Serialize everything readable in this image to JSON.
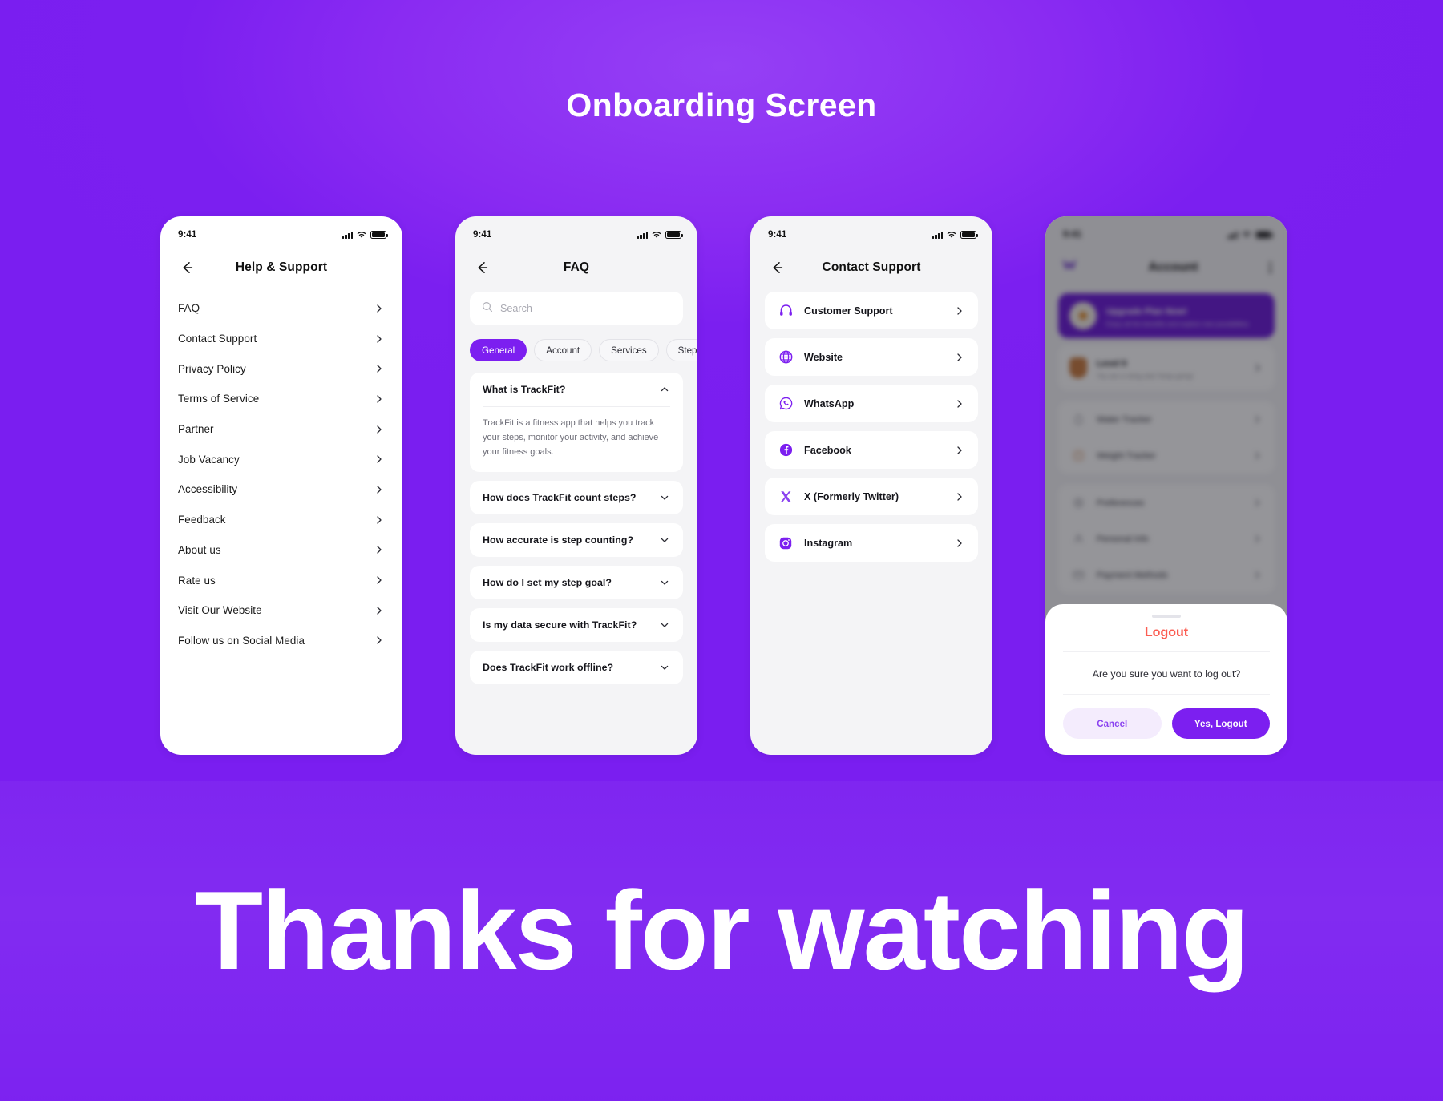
{
  "header": {
    "title": "Onboarding Screen"
  },
  "footer": {
    "title": "Thanks for watching"
  },
  "theme": {
    "brand_purple": "#7c1ff0",
    "bg_purple": "#7a1ef0",
    "danger_red": "#fb5d52",
    "card_white": "#ffffff",
    "screen_grey": "#f4f4f6"
  },
  "status_bar": {
    "time": "9:41"
  },
  "screens": {
    "help_support": {
      "nav_title": "Help & Support",
      "back_icon": "arrow-left-icon",
      "items": [
        {
          "label": "FAQ"
        },
        {
          "label": "Contact Support"
        },
        {
          "label": "Privacy Policy"
        },
        {
          "label": "Terms of Service"
        },
        {
          "label": "Partner"
        },
        {
          "label": "Job Vacancy"
        },
        {
          "label": "Accessibility"
        },
        {
          "label": "Feedback"
        },
        {
          "label": "About us"
        },
        {
          "label": "Rate us"
        },
        {
          "label": "Visit Our Website"
        },
        {
          "label": "Follow us on Social Media"
        }
      ]
    },
    "faq": {
      "nav_title": "FAQ",
      "back_icon": "arrow-left-icon",
      "search": {
        "placeholder": "Search",
        "value": "",
        "icon": "search-icon"
      },
      "chips": [
        {
          "label": "General",
          "active": true
        },
        {
          "label": "Account",
          "active": false
        },
        {
          "label": "Services",
          "active": false
        },
        {
          "label": "Steps",
          "active": false
        }
      ],
      "questions": [
        {
          "question": "What is TrackFit?",
          "expanded": true,
          "answer": "TrackFit is a fitness app that helps you track your steps, monitor your activity, and achieve your fitness goals."
        },
        {
          "question": "How does TrackFit count steps?",
          "expanded": false,
          "answer": ""
        },
        {
          "question": "How accurate is step counting?",
          "expanded": false,
          "answer": ""
        },
        {
          "question": "How do I set my step goal?",
          "expanded": false,
          "answer": ""
        },
        {
          "question": "Is my data secure with TrackFit?",
          "expanded": false,
          "answer": ""
        },
        {
          "question": "Does TrackFit work offline?",
          "expanded": false,
          "answer": ""
        }
      ]
    },
    "contact_support": {
      "nav_title": "Contact Support",
      "back_icon": "arrow-left-icon",
      "items": [
        {
          "label": "Customer Support",
          "icon": "headset-icon"
        },
        {
          "label": "Website",
          "icon": "globe-icon"
        },
        {
          "label": "WhatsApp",
          "icon": "whatsapp-icon"
        },
        {
          "label": "Facebook",
          "icon": "facebook-icon"
        },
        {
          "label": "X (Formerly Twitter)",
          "icon": "x-twitter-icon"
        },
        {
          "label": "Instagram",
          "icon": "instagram-icon"
        }
      ]
    },
    "account_logout": {
      "nav_title": "Account",
      "menu_icon": "overflow-menu-icon",
      "upgrade_banner": {
        "title": "Upgrade Plan Now!",
        "subtitle": "Enjoy all the benefits and explore new possibilities"
      },
      "level_row": {
        "title": "Level 9",
        "subtitle": "You are a rising star! Keep going!"
      },
      "rows": [
        {
          "label": "Water Tracker"
        },
        {
          "label": "Weight Tracker"
        },
        {
          "label": "Preferences"
        },
        {
          "label": "Personal Info"
        },
        {
          "label": "Payment Methods"
        }
      ],
      "logout_sheet": {
        "title": "Logout",
        "message": "Are you sure you want to log out?",
        "cancel_label": "Cancel",
        "confirm_label": "Yes, Logout"
      }
    }
  }
}
